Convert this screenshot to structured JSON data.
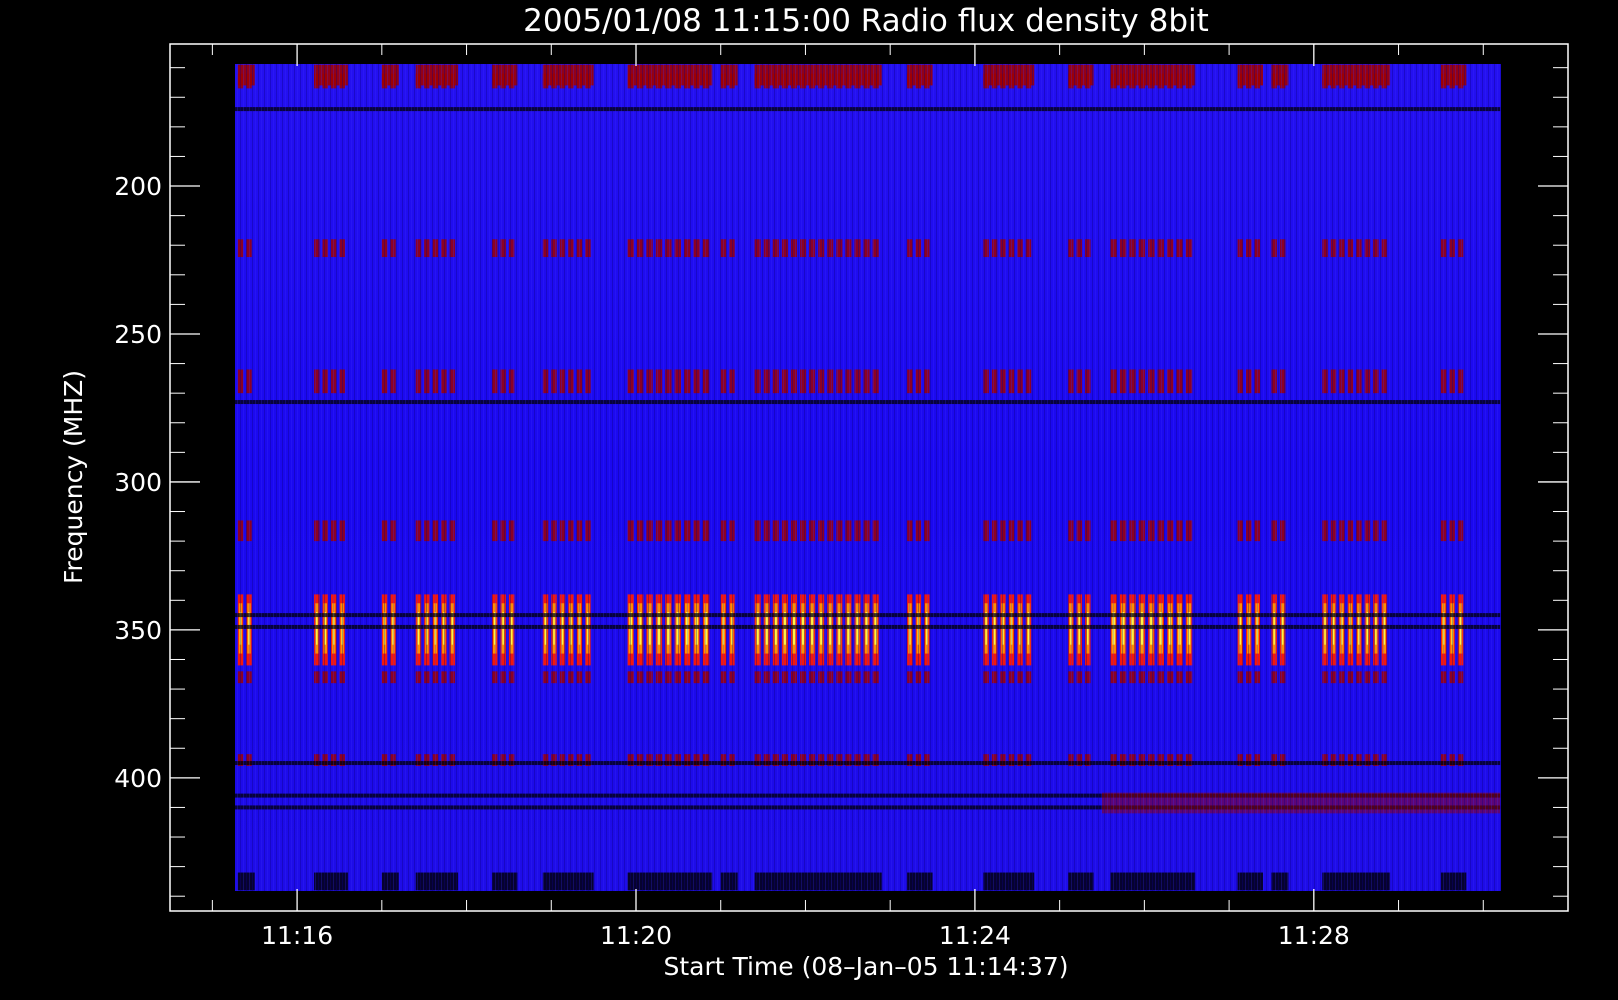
{
  "chart_data": {
    "type": "heatmap",
    "title": "2005/01/08 11:15:00 Radio flux density 8bit",
    "xlabel": "Start Time (08–Jan–05 11:14:37)",
    "ylabel": "Frequency (MHZ)",
    "x_tick_labels": [
      "11:16",
      "11:20",
      "11:24",
      "11:28"
    ],
    "x_tick_minutes": [
      16,
      20,
      24,
      28
    ],
    "x_axis_range_minutes": [
      14.5,
      31
    ],
    "x_data_range_minutes": [
      15.25,
      30.2
    ],
    "y_tick_labels": [
      "200",
      "250",
      "300",
      "350",
      "400"
    ],
    "y_tick_values": [
      200,
      250,
      300,
      350,
      400
    ],
    "y_axis_range": [
      152,
      445
    ],
    "y_data_range": [
      159,
      438
    ],
    "y_reversed": true,
    "colormap": [
      "#000000",
      "#1a00e0",
      "#2a10ff",
      "#a00000",
      "#ff1800",
      "#ff9a00",
      "#ffff50"
    ],
    "bright_time_bands_minutes": [
      [
        15.3,
        15.5
      ],
      [
        16.2,
        16.6
      ],
      [
        17.0,
        17.2
      ],
      [
        17.4,
        17.9
      ],
      [
        18.3,
        18.6
      ],
      [
        18.9,
        19.5
      ],
      [
        19.9,
        20.9
      ],
      [
        21.0,
        21.2
      ],
      [
        21.4,
        22.9
      ],
      [
        23.2,
        23.5
      ],
      [
        24.1,
        24.7
      ],
      [
        25.1,
        25.4
      ],
      [
        25.6,
        26.6
      ],
      [
        27.1,
        27.4
      ],
      [
        27.5,
        27.7
      ],
      [
        28.1,
        28.9
      ],
      [
        29.5,
        29.8
      ]
    ],
    "bright_freq_bands_mhz": [
      [
        162,
        167
      ],
      [
        218,
        224
      ],
      [
        262,
        270
      ],
      [
        313,
        320
      ],
      [
        338,
        362
      ],
      [
        364,
        368
      ],
      [
        392,
        396
      ]
    ],
    "dark_freq_lines_mhz": [
      174,
      273,
      345,
      349,
      395,
      406,
      410
    ],
    "grid": false
  }
}
